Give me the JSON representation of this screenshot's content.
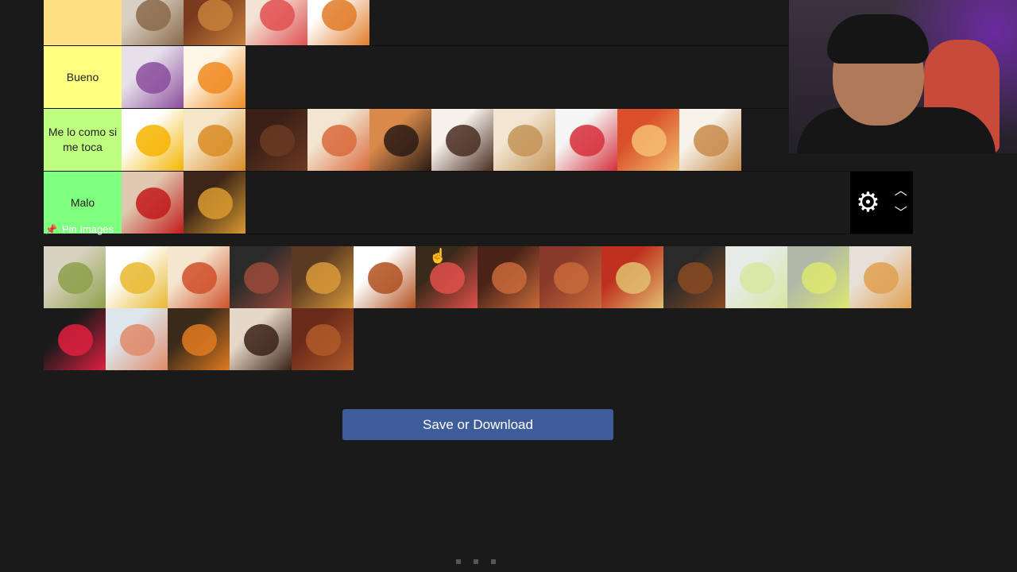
{
  "tiers": [
    {
      "label": "",
      "color": "#ffdf7f",
      "items": [
        {
          "name": "dish-plate-food",
          "c": [
            "#d9d0c4",
            "#8a6a4a"
          ]
        },
        {
          "name": "sauce-bowl-food",
          "c": [
            "#7a3b1e",
            "#c6803b"
          ]
        },
        {
          "name": "salad-plate-food",
          "c": [
            "#f2e3d5",
            "#e05050"
          ]
        },
        {
          "name": "papaya-food",
          "c": [
            "#ffffff",
            "#e07b28"
          ]
        }
      ]
    },
    {
      "label": "Bueno",
      "color": "#ffff7f",
      "items": [
        {
          "name": "berry-smoothie-food",
          "c": [
            "#e7e0ea",
            "#8b4d9c"
          ]
        },
        {
          "name": "papaya-slice-food",
          "c": [
            "#fff6e8",
            "#f08a20"
          ]
        }
      ]
    },
    {
      "label": "Me lo como si me toca",
      "color": "#bfff7f",
      "items": [
        {
          "name": "orange-soda-food",
          "c": [
            "#ffffff",
            "#f4b400"
          ]
        },
        {
          "name": "chicken-fries-food",
          "c": [
            "#f6e6c8",
            "#d98c25"
          ]
        },
        {
          "name": "chocolates-food",
          "c": [
            "#3a2016",
            "#6b3a22"
          ]
        },
        {
          "name": "pancakes-food",
          "c": [
            "#f3e5d0",
            "#d96a3d"
          ]
        },
        {
          "name": "chocolate-cake-food",
          "c": [
            "#d98a4a",
            "#2a1a14"
          ]
        },
        {
          "name": "chocolate-mousse-food",
          "c": [
            "#f6f1ea",
            "#4a2d22"
          ]
        },
        {
          "name": "cookies-food",
          "c": [
            "#f2e6d2",
            "#c49357"
          ]
        },
        {
          "name": "strawberry-jelly-food",
          "c": [
            "#f5f5f5",
            "#d62f3a"
          ]
        },
        {
          "name": "flan-food",
          "c": [
            "#d9502a",
            "#f3c070"
          ]
        },
        {
          "name": "fried-fish-food",
          "c": [
            "#f7f3ea",
            "#c88b4a"
          ]
        }
      ]
    },
    {
      "label": "Malo",
      "color": "#7fff7f",
      "items": [
        {
          "name": "coca-cola-food",
          "c": [
            "#e0c9b0",
            "#c21b1b"
          ]
        },
        {
          "name": "chocolate-eclairs-food",
          "c": [
            "#3b2418",
            "#d99a30"
          ]
        }
      ]
    }
  ],
  "pin_images_label": "Pin Images",
  "pool": [
    {
      "name": "ceviche-food",
      "c": [
        "#d8d2c0",
        "#8da04a"
      ]
    },
    {
      "name": "pineapple-food",
      "c": [
        "#ffffff",
        "#e8b830"
      ]
    },
    {
      "name": "pizza-food",
      "c": [
        "#f4e6cf",
        "#d0502a"
      ]
    },
    {
      "name": "octopus-food",
      "c": [
        "#2a2a2a",
        "#9a4a3a"
      ]
    },
    {
      "name": "burger-food",
      "c": [
        "#5a3a22",
        "#d99a3a"
      ]
    },
    {
      "name": "spaghetti-chicken-food",
      "c": [
        "#ffffff",
        "#b0501e"
      ]
    },
    {
      "name": "fruit-salad-food",
      "c": [
        "#3a2a1a",
        "#e0504a"
      ]
    },
    {
      "name": "grilled-pork-food",
      "c": [
        "#4a2218",
        "#c86a3a"
      ]
    },
    {
      "name": "roast-pig-food",
      "c": [
        "#8a3a2a",
        "#c86a3a"
      ]
    },
    {
      "name": "chaufa-plate-food",
      "c": [
        "#c0301f",
        "#e0c070"
      ]
    },
    {
      "name": "fried-chicken-food",
      "c": [
        "#2a2a2a",
        "#8a4a22"
      ]
    },
    {
      "name": "lemonade-food",
      "c": [
        "#e6ebe8",
        "#d8e6a0"
      ]
    },
    {
      "name": "lime-drink-food",
      "c": [
        "#b0b8a8",
        "#dde870"
      ]
    },
    {
      "name": "bread-rolls-food",
      "c": [
        "#e8e0d8",
        "#e0a050"
      ]
    },
    {
      "name": "red-cocktail-food",
      "c": [
        "#1a1a1a",
        "#e02040"
      ]
    },
    {
      "name": "shrimp-salad-food",
      "c": [
        "#dde6ea",
        "#e08a6a"
      ]
    },
    {
      "name": "fish-plate-food",
      "c": [
        "#3a2a1a",
        "#e07a20"
      ]
    },
    {
      "name": "chocolate-cake-slice-food",
      "c": [
        "#e6d8c8",
        "#3a2218"
      ]
    },
    {
      "name": "pulled-meat-food",
      "c": [
        "#6a2a1a",
        "#b05a2a"
      ]
    }
  ],
  "save_button_label": "Save or Download",
  "controls": {
    "gear": "settings",
    "up": "up",
    "down": "down"
  }
}
